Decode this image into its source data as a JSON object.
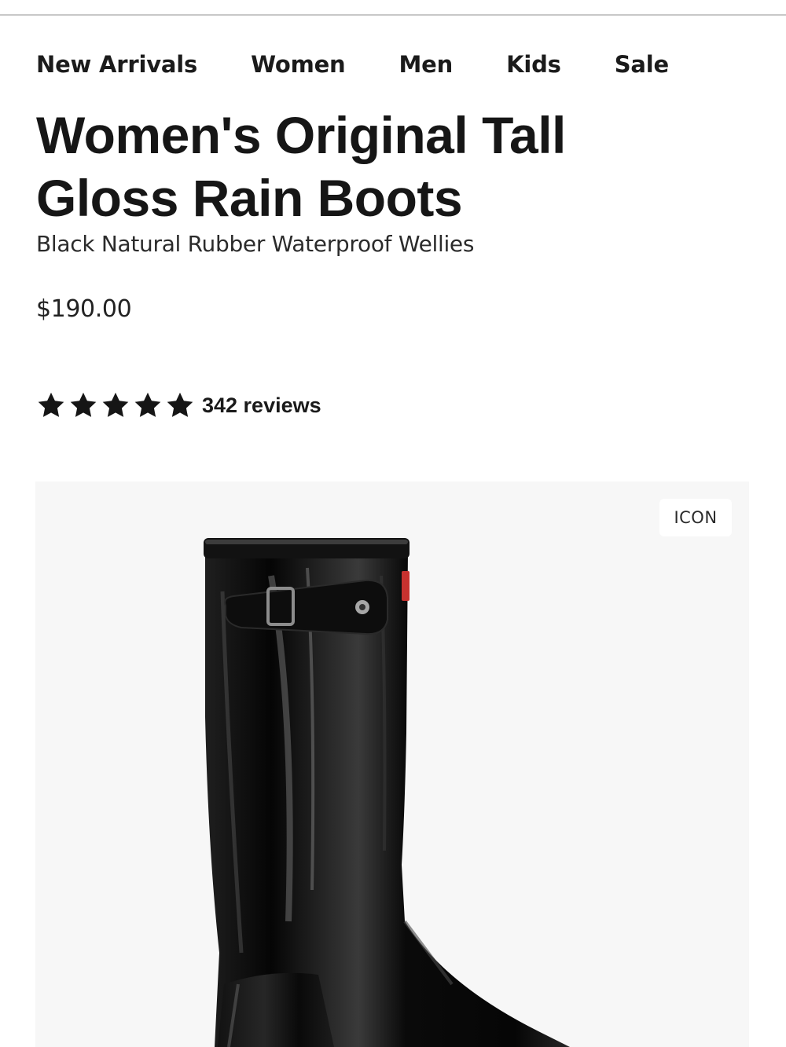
{
  "nav": {
    "items": [
      {
        "label": "New Arrivals"
      },
      {
        "label": "Women"
      },
      {
        "label": "Men"
      },
      {
        "label": "Kids"
      },
      {
        "label": "Sale"
      }
    ]
  },
  "product": {
    "title": "Women's Original Tall Gloss Rain Boots",
    "subtitle": "Black Natural Rubber Waterproof Wellies",
    "price": "$190.00",
    "rating": {
      "stars": 5,
      "max_stars": 5,
      "reviews_label": "342 reviews"
    },
    "gallery": {
      "badge": "ICON",
      "image": "black-gloss-tall-rain-boot"
    }
  },
  "colors": {
    "text": "#151515",
    "gallery_background": "#f7f7f7",
    "divider": "#c8c8c8",
    "boot": "#0b0b0b",
    "logo_accent": "#c8322f"
  }
}
